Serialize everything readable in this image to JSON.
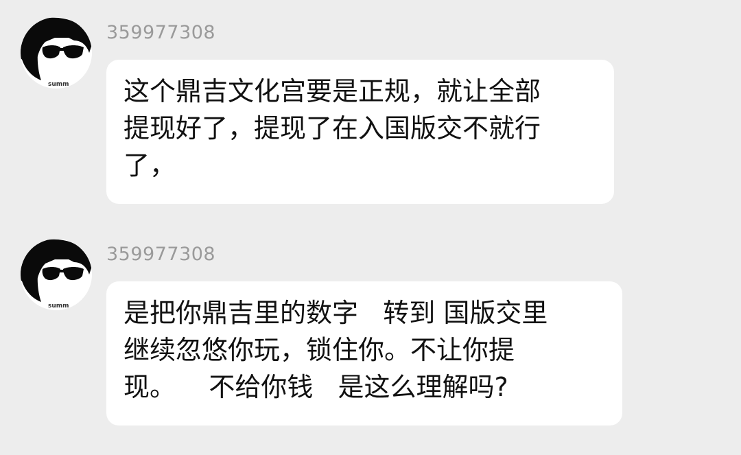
{
  "messages": [
    {
      "sender": "359977308",
      "avatar_icon": "sunglasses-avatar-icon",
      "avatar_caption": "summ",
      "text": "这个鼎吉文化宫要是正规，就让全部\n提现好了，提现了在入国版交不就行\n了，"
    },
    {
      "sender": "359977308",
      "avatar_icon": "sunglasses-avatar-icon",
      "avatar_caption": "summ",
      "text": "是把你鼎吉里的数字   转到 国版交里\n继续忽悠你玩，锁住你。不让你提\n现。    不给你钱   是这么理解吗?"
    }
  ],
  "colors": {
    "background": "#ededed",
    "bubble": "#ffffff",
    "sender_text": "#9a9a9a",
    "message_text": "#111111"
  }
}
